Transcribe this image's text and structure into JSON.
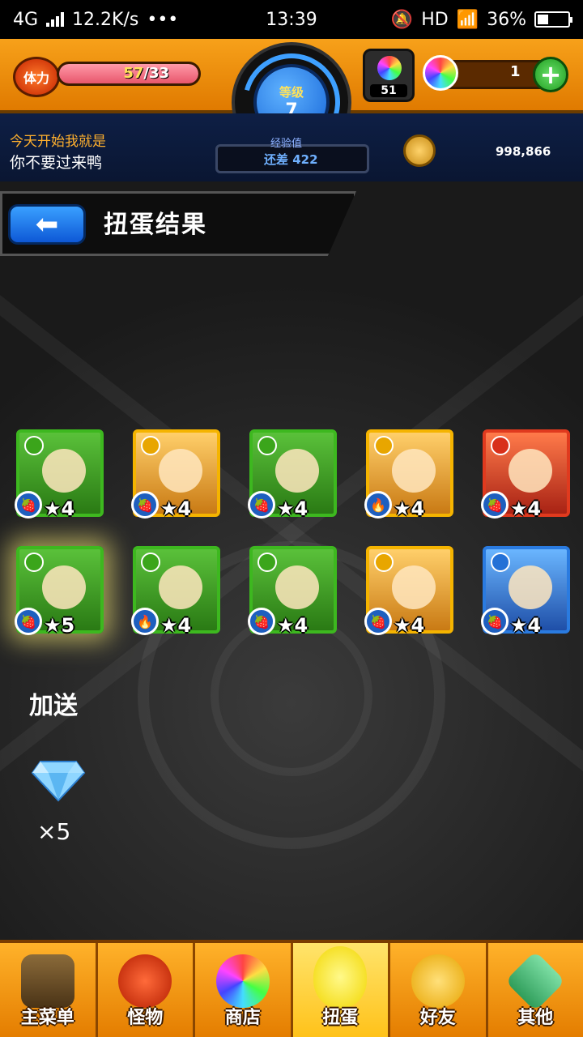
{
  "status_bar": {
    "network": "4G",
    "speed": "12.2K/s",
    "dots": "•••",
    "time": "13:39",
    "hd": "HD",
    "battery": "36%",
    "battery_level": 0.36
  },
  "header": {
    "stamina_label": "体力",
    "stamina_current": "57",
    "stamina_max": "/33",
    "stamina_fraction": 1.0,
    "level_label": "等级",
    "level_value": "7",
    "orb_count": "51",
    "gem_count": "1",
    "plus": "+"
  },
  "subheader": {
    "line1": "今天开始我就是",
    "line2": "你不要过来鸭",
    "exp_label": "经验值",
    "exp_text": "还差 422",
    "coins": "998,866"
  },
  "page": {
    "back_arrow": "⬅",
    "title": "扭蛋结果"
  },
  "cards": [
    {
      "stars": "★4",
      "element": "wood",
      "badge": "🍓"
    },
    {
      "stars": "★4",
      "element": "light",
      "badge": "🍓"
    },
    {
      "stars": "★4",
      "element": "wood",
      "badge": "🍓"
    },
    {
      "stars": "★4",
      "element": "light",
      "badge": "🔥"
    },
    {
      "stars": "★4",
      "element": "fire",
      "badge": "🍓"
    },
    {
      "stars": "★5",
      "element": "wood",
      "badge": "🍓"
    },
    {
      "stars": "★4",
      "element": "wood",
      "badge": "🔥"
    },
    {
      "stars": "★4",
      "element": "wood",
      "badge": "🍓"
    },
    {
      "stars": "★4",
      "element": "light",
      "badge": "🍓"
    },
    {
      "stars": "★4",
      "element": "water",
      "badge": "🍓"
    }
  ],
  "bonus": {
    "label": "加送",
    "count": "×5"
  },
  "nav": [
    {
      "label": "主菜单"
    },
    {
      "label": "怪物"
    },
    {
      "label": "商店"
    },
    {
      "label": "扭蛋"
    },
    {
      "label": "好友"
    },
    {
      "label": "其他"
    }
  ],
  "colors": {
    "wood": "#3db81f",
    "light": "#f5b400",
    "fire": "#e03a1e",
    "water": "#2a7be0"
  }
}
